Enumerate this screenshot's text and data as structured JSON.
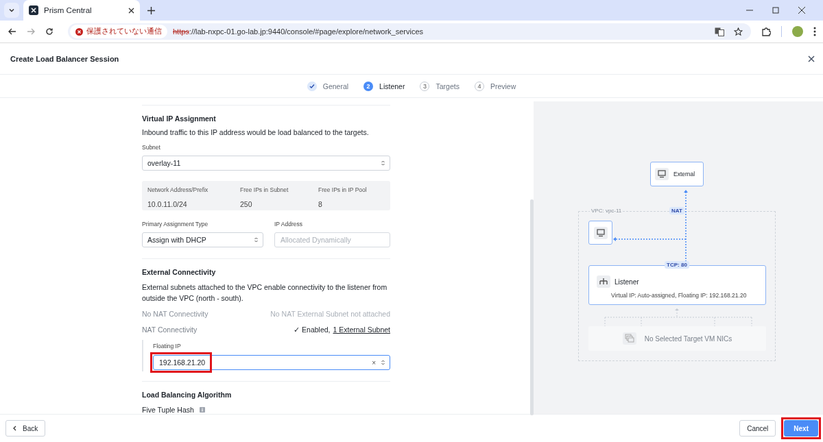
{
  "browser": {
    "tab_title": "Prism Central",
    "security_warning": "保護されていない通信",
    "url_scheme": "https",
    "url_rest": "://lab-nxpc-01.go-lab.jp:9440/console/#page/explore/network_services"
  },
  "dialog": {
    "title": "Create Load Balancer Session"
  },
  "steps": [
    {
      "label": "General",
      "completed": true,
      "selected": false
    },
    {
      "number": "2",
      "label": "Listener",
      "completed": false,
      "selected": true
    },
    {
      "number": "3",
      "label": "Targets",
      "completed": false,
      "selected": false
    },
    {
      "number": "4",
      "label": "Preview",
      "completed": false,
      "selected": false
    }
  ],
  "virtual_ip": {
    "heading": "Virtual IP Assignment",
    "description": "Inbound traffic to this IP address would be load balanced to the targets.",
    "subnet_label": "Subnet",
    "subnet_value": "overlay-11",
    "info": [
      {
        "label": "Network Address/Prefix",
        "value": "10.0.11.0/24"
      },
      {
        "label": "Free IPs in Subnet",
        "value": "250"
      },
      {
        "label": "Free IPs in IP Pool",
        "value": "8"
      }
    ],
    "assignment_label": "Primary Assignment Type",
    "assignment_value": "Assign with DHCP",
    "ip_label": "IP Address",
    "ip_placeholder": "Allocated Dynamically"
  },
  "external": {
    "heading": "External Connectivity",
    "description": "External subnets attached to the VPC enable connectivity to the listener from outside the VPC (north - south).",
    "rows": [
      {
        "label": "No NAT Connectivity",
        "status": "No NAT External Subnet not attached",
        "enabled": false
      },
      {
        "label": "NAT Connectivity",
        "status": "✓ Enabled,",
        "link": "1 External Subnet",
        "enabled": true
      }
    ],
    "floating_ip_label": "Floating IP",
    "floating_ip_value": "192.168.21.20",
    "clear_glyph": "×",
    "highlighted": true
  },
  "algorithm": {
    "heading": "Load Balancing Algorithm",
    "value": "Five Tuple Hash"
  },
  "diagram": {
    "external_label": "External",
    "vpc_label": "VPC: vpc-11",
    "nat_label": "NAT",
    "port_label": "TCP: 80",
    "listener_title": "Listener",
    "listener_detail": "Virtual IP: Auto-assigned,  Floating IP: 192.168.21.20",
    "targets_label": "No Selected Target VM NICs"
  },
  "footer": {
    "back": "Back",
    "cancel": "Cancel",
    "next": "Next",
    "next_highlighted": true
  }
}
